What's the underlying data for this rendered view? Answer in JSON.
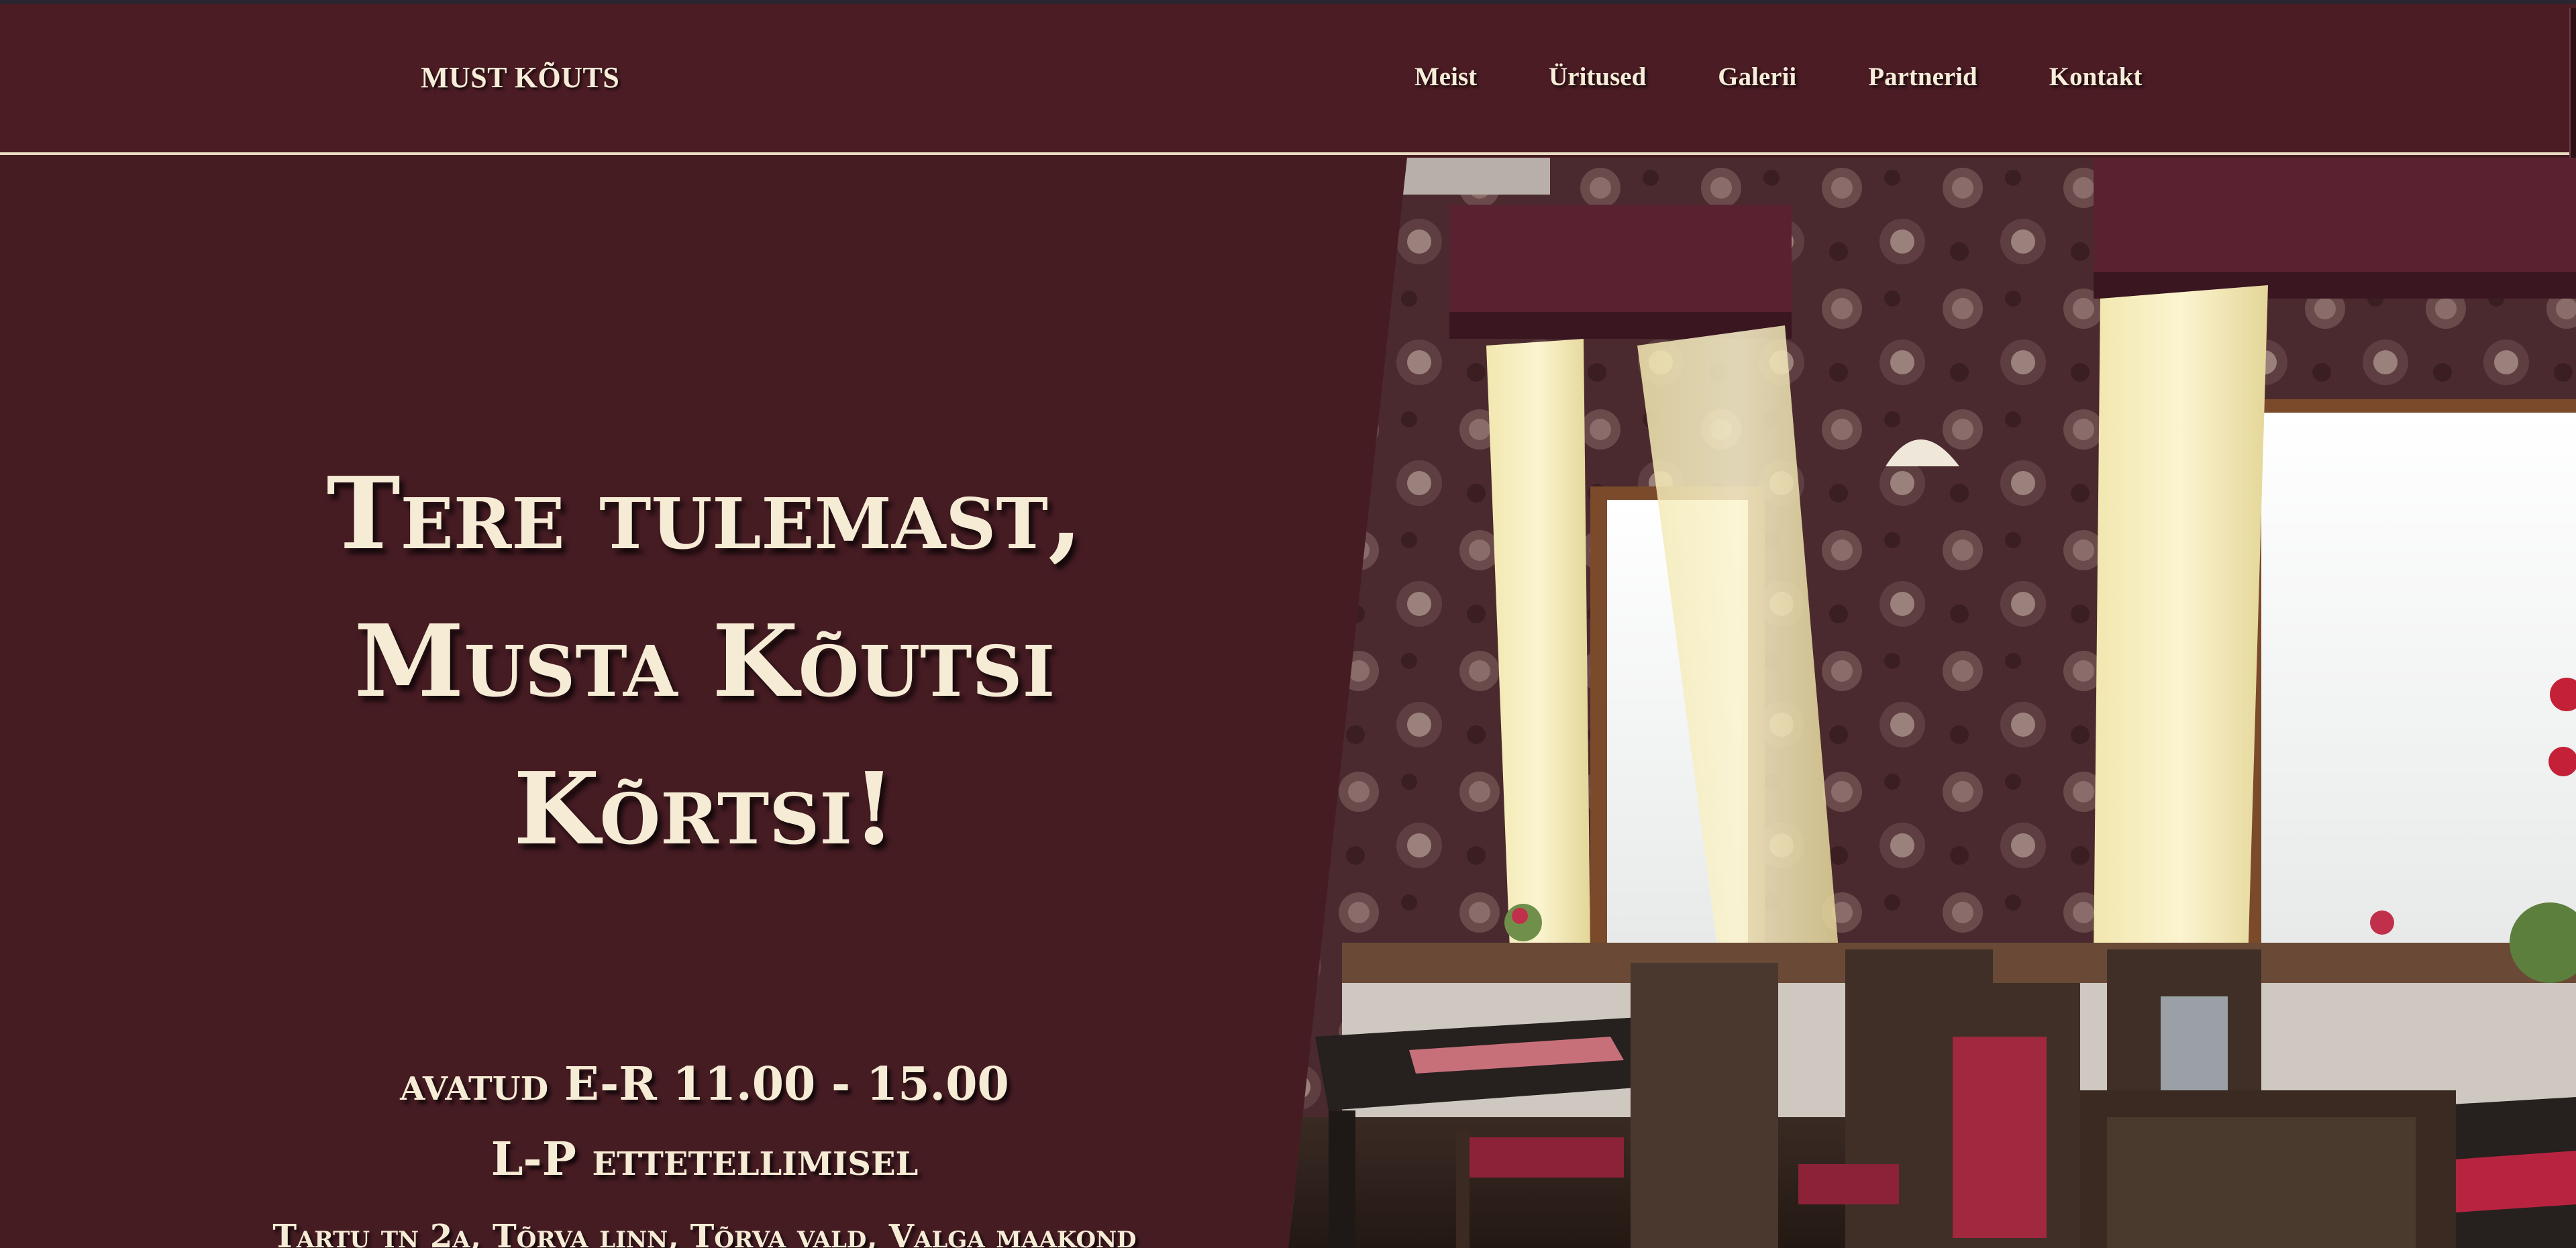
{
  "header": {
    "brand": "MUST KÕUTS",
    "nav": [
      "Meist",
      "Üritused",
      "Galerii",
      "Partnerid",
      "Kontakt"
    ]
  },
  "hero": {
    "headline": [
      "Tere tulemast,",
      "Musta Kõutsi",
      "Kõrtsi!"
    ],
    "hours": [
      "avatud E-R 11.00 - 15.00",
      "L-P ettetellimisel"
    ],
    "address": "Tartu tn 2a, Tõrva linn, Tõrva vald, Valga maakond"
  },
  "colors": {
    "background": "#461c23",
    "navbar": "#4b1c24",
    "text": "#f6ecd6",
    "divider": "#e9dcc2"
  }
}
